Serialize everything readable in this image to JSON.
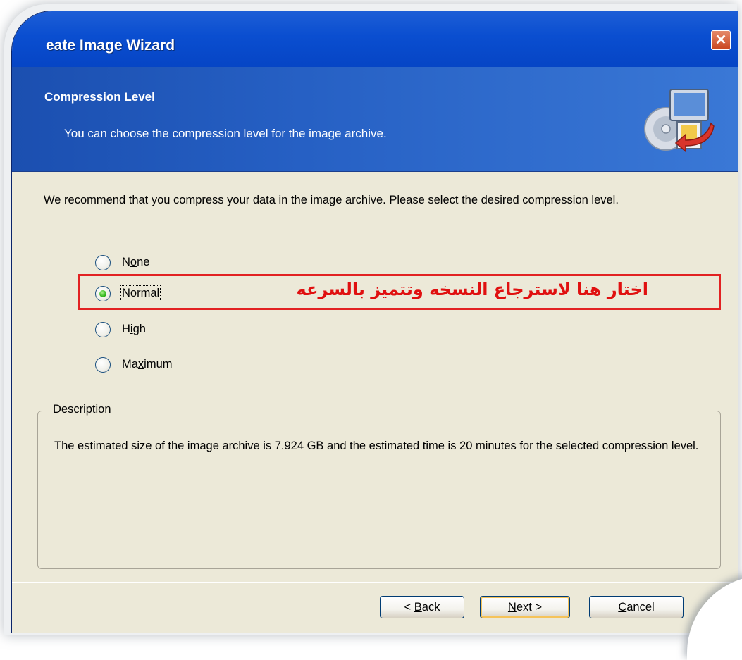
{
  "window": {
    "title": "eate Image Wizard",
    "close_symbol": "✕"
  },
  "header": {
    "title": "Compression Level",
    "subtitle": "You can choose the compression level for the image archive.",
    "icon": "backup-disk-icon"
  },
  "content": {
    "intro": "We recommend that you compress your data in the image archive. Please select the desired compression level.",
    "options": [
      {
        "label_pre": "N",
        "label_ul": "o",
        "label_post": "ne",
        "selected": false
      },
      {
        "label_pre": "",
        "label_ul": "",
        "label_post": "Normal",
        "selected": true
      },
      {
        "label_pre": "H",
        "label_ul": "i",
        "label_post": "gh",
        "selected": false
      },
      {
        "label_pre": "Ma",
        "label_ul": "x",
        "label_post": "imum",
        "selected": false
      }
    ],
    "annotation": "اختار هنا لاسترجاع النسخه وتتميز بالسرعه",
    "description": {
      "legend": "Description",
      "text": "The estimated size of the image archive is 7.924 GB and the estimated time is 20 minutes for the selected compression level."
    }
  },
  "buttons": {
    "back": {
      "pre": "< ",
      "ul": "B",
      "post": "ack"
    },
    "next": {
      "pre": "",
      "ul": "N",
      "post": "ext >"
    },
    "cancel": {
      "pre": "",
      "ul": "C",
      "post": "ancel"
    }
  },
  "colors": {
    "title_bar": "#0a4ed0",
    "header_band": "#2660c4",
    "dialog_bg": "#ece9d8",
    "annotation": "#e01010",
    "close_button": "#c9461f"
  }
}
